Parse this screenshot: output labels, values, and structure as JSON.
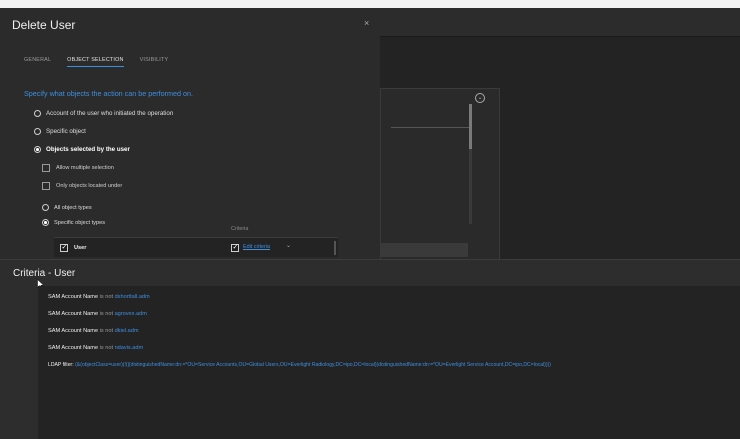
{
  "dialog": {
    "title": "Delete User",
    "close_glyph": "×",
    "tabs": [
      {
        "label": "GENERAL",
        "active": false
      },
      {
        "label": "OBJECT SELECTION",
        "active": true
      },
      {
        "label": "VISIBILITY",
        "active": false
      }
    ],
    "prompt": "Specify what objects the action can be performed on.",
    "options": [
      {
        "label": "Account of the user who initiated the operation",
        "selected": false
      },
      {
        "label": "Specific object",
        "selected": false
      },
      {
        "label": "Objects selected by the user",
        "selected": true
      }
    ],
    "checks": [
      {
        "label": "Allow multiple selection",
        "checked": false
      },
      {
        "label": "Only objects located under",
        "checked": false
      }
    ],
    "type_options": [
      {
        "label": "All object types",
        "selected": false
      },
      {
        "label": "Specific object types",
        "selected": true
      }
    ],
    "criteria_header": "Criteria",
    "type_row": {
      "label": "User",
      "checked": true,
      "edit_label": "Edit criteria",
      "chevron": "⌄"
    }
  },
  "criteria_panel": {
    "title": "Criteria - User",
    "rules": [
      {
        "field": "SAM Account Name",
        "op": "is not",
        "value": "dshorttall.adm"
      },
      {
        "field": "SAM Account Name",
        "op": "is not",
        "value": "agroves.adm"
      },
      {
        "field": "SAM Account Name",
        "op": "is not",
        "value": "dkiel.adm"
      },
      {
        "field": "SAM Account Name",
        "op": "is not",
        "value": "ndavis.adm"
      }
    ],
    "ldap": {
      "label": "LDAP filter:",
      "value": "(&(objectClass=user)(!(|(distinguishedName:dn:=*OU=Service Accounts,OU=Global Users,OU=Everlight Radiology,DC=ipo,DC=local)(distinguishedName:dn:=*OU=Everlight Service Account,DC=ipo,DC=local))))"
    }
  },
  "colors": {
    "accent": "#3d8fe0",
    "dialog_bg": "#2b2b2b",
    "panel_bg": "#2d2d2d"
  }
}
